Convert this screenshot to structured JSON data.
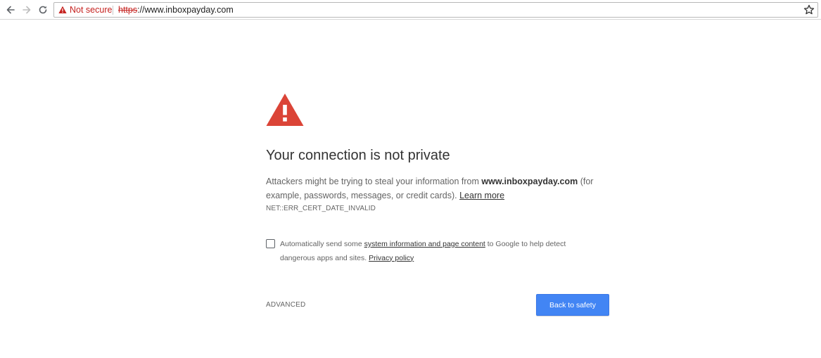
{
  "browser": {
    "back_icon": "arrow-left-icon",
    "forward_icon": "arrow-right-icon",
    "reload_icon": "reload-icon",
    "security_state": {
      "icon": "warning-triangle-icon",
      "label": "Not secure",
      "color": "#c5221f"
    },
    "url": {
      "scheme": "https",
      "rest": "://www.inboxpayday.com"
    },
    "bookmark_icon": "star-icon"
  },
  "interstitial": {
    "icon": "warning-triangle-icon",
    "icon_color": "#db4437",
    "heading": "Your connection is not private",
    "message": {
      "before_domain": "Attackers might be trying to steal your information from ",
      "domain": "www.inboxpayday.com",
      "after_domain": " (for example, passwords, messages, or credit cards). ",
      "learn_more": "Learn more"
    },
    "error_code": "NET::ERR_CERT_DATE_INVALID",
    "extended_reporting": {
      "checked": false,
      "text_before": "Automatically send some ",
      "link1": "system information and page content",
      "text_middle": " to Google to help detect dangerous apps and sites. ",
      "link2": "Privacy policy"
    },
    "advanced_label": "ADVANCED",
    "primary_button_label": "Back to safety",
    "primary_color": "#4285f4"
  }
}
